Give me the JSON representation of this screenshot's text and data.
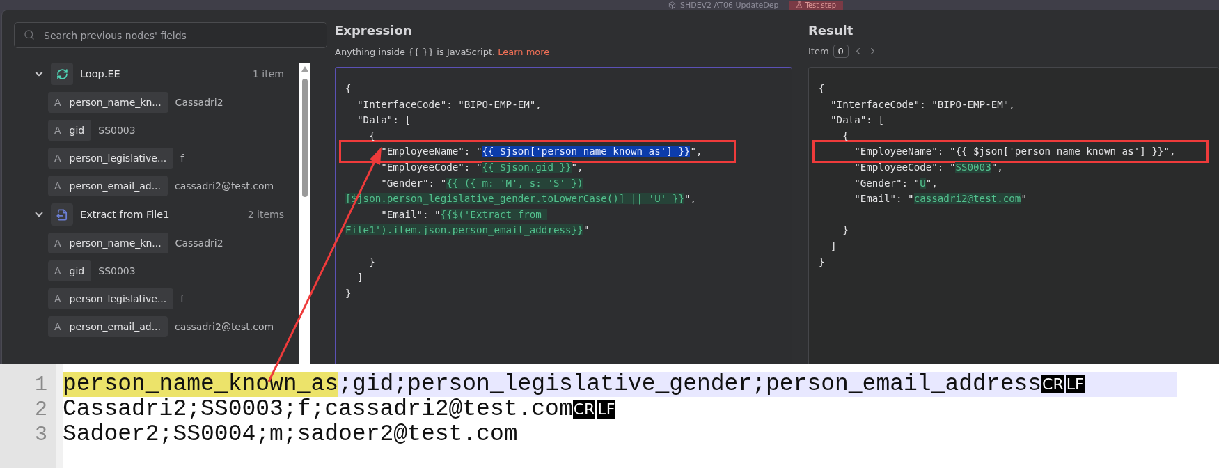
{
  "header": {
    "workflow": "SHDEV2 AT06 UpdateDep",
    "test_button": "Test step"
  },
  "search": {
    "placeholder": "Search previous nodes' fields"
  },
  "nodes": [
    {
      "name": "Loop.EE",
      "kind": "loop",
      "count": "1 item",
      "expanded": true,
      "fields": [
        {
          "type": "A",
          "name": "person_name_kn...",
          "value": "Cassadri2"
        },
        {
          "type": "A",
          "name": "gid",
          "value": "SS0003"
        },
        {
          "type": "A",
          "name": "person_legislative...",
          "value": "f"
        },
        {
          "type": "A",
          "name": "person_email_ad...",
          "value": "cassadri2@test.com"
        }
      ]
    },
    {
      "name": "Extract from File1",
      "kind": "extract",
      "count": "2 items",
      "expanded": true,
      "fields": [
        {
          "type": "A",
          "name": "person_name_kn...",
          "value": "Cassadri2"
        },
        {
          "type": "A",
          "name": "gid",
          "value": "SS0003"
        },
        {
          "type": "A",
          "name": "person_legislative...",
          "value": "f"
        },
        {
          "type": "A",
          "name": "person_email_ad...",
          "value": "cassadri2@test.com"
        }
      ]
    }
  ],
  "expression": {
    "title": "Expression",
    "hint": "Anything inside {{  }} is JavaScript.",
    "link": "Learn more",
    "lines": [
      {
        "segments": [
          {
            "text": "{",
            "kind": "plain"
          }
        ]
      },
      {
        "segments": [
          {
            "text": "  \"InterfaceCode\": \"BIPO-EMP-EM\",",
            "kind": "plain"
          }
        ]
      },
      {
        "segments": [
          {
            "text": "  \"Data\": [",
            "kind": "plain"
          }
        ]
      },
      {
        "segments": [
          {
            "text": "    {",
            "kind": "plain"
          }
        ]
      },
      {
        "segments": [
          {
            "text": "      \"EmployeeName\": \"",
            "kind": "plain"
          },
          {
            "text": "{{ $json['person_name_known_as'] }}",
            "kind": "selected"
          },
          {
            "text": "\",",
            "kind": "plain"
          }
        ],
        "framed": true
      },
      {
        "segments": [
          {
            "text": "      \"EmployeeCode\": \"",
            "kind": "plain"
          },
          {
            "text": "{{ $json.gid }}",
            "kind": "expr"
          },
          {
            "text": "\",",
            "kind": "plain"
          }
        ]
      },
      {
        "segments": [
          {
            "text": "      \"Gender\": \"",
            "kind": "plain"
          },
          {
            "text": "{{ ({ m: 'M', s: 'S' })",
            "kind": "expr"
          }
        ]
      },
      {
        "segments": [
          {
            "text": "[$json.person_legislative_gender.toLowerCase()] || 'U' }}",
            "kind": "expr"
          },
          {
            "text": "\",",
            "kind": "plain"
          }
        ]
      },
      {
        "segments": [
          {
            "text": "      \"Email\": \"",
            "kind": "plain"
          },
          {
            "text": "{{$('Extract from ",
            "kind": "expr"
          }
        ]
      },
      {
        "segments": [
          {
            "text": "File1').item.json.person_email_address}}",
            "kind": "expr"
          },
          {
            "text": "\"",
            "kind": "plain"
          }
        ],
        "blank_after": true
      },
      {
        "segments": [
          {
            "text": "    }",
            "kind": "plain"
          }
        ]
      },
      {
        "segments": [
          {
            "text": "  ]",
            "kind": "plain"
          }
        ]
      },
      {
        "segments": [
          {
            "text": "}",
            "kind": "plain"
          }
        ]
      }
    ]
  },
  "result": {
    "title": "Result",
    "item_label": "Item",
    "item_index": "0",
    "lines": [
      {
        "segments": [
          {
            "text": "{",
            "kind": "plain"
          }
        ]
      },
      {
        "segments": [
          {
            "text": "  \"InterfaceCode\": \"BIPO-EMP-EM\",",
            "kind": "plain"
          }
        ]
      },
      {
        "segments": [
          {
            "text": "  \"Data\": [",
            "kind": "plain"
          }
        ]
      },
      {
        "segments": [
          {
            "text": "    {",
            "kind": "plain"
          }
        ]
      },
      {
        "segments": [
          {
            "text": "      \"EmployeeName\": \"{{ $json['person_name_known_as'] }}\",",
            "kind": "plain"
          }
        ],
        "framed": true
      },
      {
        "segments": [
          {
            "text": "      \"EmployeeCode\": \"",
            "kind": "plain"
          },
          {
            "text": "SS0003",
            "kind": "expr"
          },
          {
            "text": "\",",
            "kind": "plain"
          }
        ]
      },
      {
        "segments": [
          {
            "text": "      \"Gender\": \"",
            "kind": "plain"
          },
          {
            "text": "U",
            "kind": "expr"
          },
          {
            "text": "\",",
            "kind": "plain"
          }
        ]
      },
      {
        "segments": [
          {
            "text": "      \"Email\": \"",
            "kind": "plain"
          },
          {
            "text": "cassadri2@test.com",
            "kind": "expr"
          },
          {
            "text": "\"",
            "kind": "plain"
          }
        ],
        "blank_after": true
      },
      {
        "segments": [
          {
            "text": "    }",
            "kind": "plain"
          }
        ]
      },
      {
        "segments": [
          {
            "text": "  ]",
            "kind": "plain"
          }
        ]
      },
      {
        "segments": [
          {
            "text": "}",
            "kind": "plain"
          }
        ]
      }
    ]
  },
  "file": {
    "lines": [
      {
        "number": "1",
        "current": true,
        "segments": [
          {
            "text": "person_name_known_as",
            "kind": "highlight"
          },
          {
            "text": ";gid;person_legislative_gender;person_email_address",
            "kind": "plain"
          },
          {
            "text": "CR",
            "kind": "eol"
          },
          {
            "text": "LF",
            "kind": "eol"
          }
        ]
      },
      {
        "number": "2",
        "current": false,
        "segments": [
          {
            "text": "Cassadri2;SS0003;f;cassadri2@test.com",
            "kind": "plain"
          },
          {
            "text": "CR",
            "kind": "eol"
          },
          {
            "text": "LF",
            "kind": "eol"
          }
        ]
      },
      {
        "number": "3",
        "current": false,
        "segments": [
          {
            "text": "Sadoer2;SS0004;m;sadoer2@test.com",
            "kind": "plain"
          }
        ]
      }
    ]
  }
}
